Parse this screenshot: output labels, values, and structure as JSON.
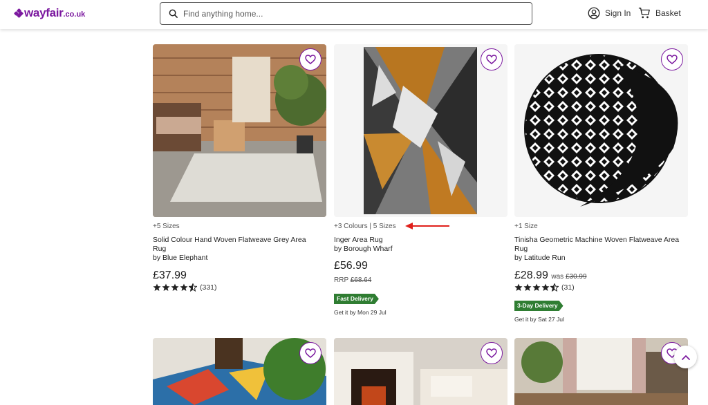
{
  "header": {
    "logo_word": "wayfair",
    "logo_tld": ".co.uk",
    "search_placeholder": "Find anything home...",
    "sign_in": "Sign In",
    "basket": "Basket"
  },
  "products": [
    {
      "options": "+5 Sizes",
      "title_line1": "Solid Colour Hand Woven Flatweave Grey Area",
      "title_line2": "Rug",
      "brand": "by Blue Elephant",
      "price": "£37.99",
      "rating_count": "(331)",
      "rating": 4.5
    },
    {
      "options": "+3 Colours | 5 Sizes",
      "title_line1": "Inger Area Rug",
      "brand": "by Borough Wharf",
      "price": "£56.99",
      "rrp_label": "RRP",
      "rrp_value": "£68.64",
      "badge": "Fast Delivery",
      "eta": "Get it by Mon 29 Jul"
    },
    {
      "options": "+1 Size",
      "title_line1": "Tinisha Geometric Machine Woven Flatweave Area",
      "title_line2": "Rug",
      "brand": "by Latitude Run",
      "price": "£28.99",
      "was_label": "was",
      "was_value": "£30.99",
      "rating_count": "(31)",
      "rating": 4.5,
      "badge": "3-Day Delivery",
      "eta": "Get it by Sat 27 Jul"
    }
  ],
  "icons": [
    "search-icon",
    "account-icon",
    "basket-icon",
    "heart-icon",
    "star-icon",
    "chevron-up-icon"
  ],
  "colors": {
    "brand": "#7b189f",
    "badge": "#2f7d32",
    "annotation_arrow": "#e0201b"
  }
}
